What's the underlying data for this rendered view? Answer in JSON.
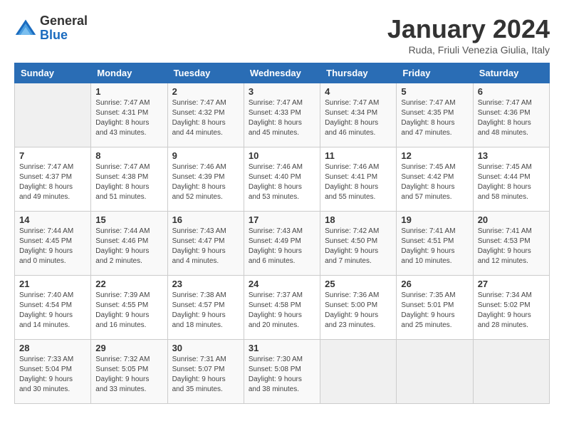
{
  "logo": {
    "general": "General",
    "blue": "Blue"
  },
  "header": {
    "month_title": "January 2024",
    "subtitle": "Ruda, Friuli Venezia Giulia, Italy"
  },
  "weekdays": [
    "Sunday",
    "Monday",
    "Tuesday",
    "Wednesday",
    "Thursday",
    "Friday",
    "Saturday"
  ],
  "weeks": [
    [
      {
        "day": "",
        "sunrise": "",
        "sunset": "",
        "daylight": ""
      },
      {
        "day": "1",
        "sunrise": "Sunrise: 7:47 AM",
        "sunset": "Sunset: 4:31 PM",
        "daylight": "Daylight: 8 hours and 43 minutes."
      },
      {
        "day": "2",
        "sunrise": "Sunrise: 7:47 AM",
        "sunset": "Sunset: 4:32 PM",
        "daylight": "Daylight: 8 hours and 44 minutes."
      },
      {
        "day": "3",
        "sunrise": "Sunrise: 7:47 AM",
        "sunset": "Sunset: 4:33 PM",
        "daylight": "Daylight: 8 hours and 45 minutes."
      },
      {
        "day": "4",
        "sunrise": "Sunrise: 7:47 AM",
        "sunset": "Sunset: 4:34 PM",
        "daylight": "Daylight: 8 hours and 46 minutes."
      },
      {
        "day": "5",
        "sunrise": "Sunrise: 7:47 AM",
        "sunset": "Sunset: 4:35 PM",
        "daylight": "Daylight: 8 hours and 47 minutes."
      },
      {
        "day": "6",
        "sunrise": "Sunrise: 7:47 AM",
        "sunset": "Sunset: 4:36 PM",
        "daylight": "Daylight: 8 hours and 48 minutes."
      }
    ],
    [
      {
        "day": "7",
        "sunrise": "Sunrise: 7:47 AM",
        "sunset": "Sunset: 4:37 PM",
        "daylight": "Daylight: 8 hours and 49 minutes."
      },
      {
        "day": "8",
        "sunrise": "Sunrise: 7:47 AM",
        "sunset": "Sunset: 4:38 PM",
        "daylight": "Daylight: 8 hours and 51 minutes."
      },
      {
        "day": "9",
        "sunrise": "Sunrise: 7:46 AM",
        "sunset": "Sunset: 4:39 PM",
        "daylight": "Daylight: 8 hours and 52 minutes."
      },
      {
        "day": "10",
        "sunrise": "Sunrise: 7:46 AM",
        "sunset": "Sunset: 4:40 PM",
        "daylight": "Daylight: 8 hours and 53 minutes."
      },
      {
        "day": "11",
        "sunrise": "Sunrise: 7:46 AM",
        "sunset": "Sunset: 4:41 PM",
        "daylight": "Daylight: 8 hours and 55 minutes."
      },
      {
        "day": "12",
        "sunrise": "Sunrise: 7:45 AM",
        "sunset": "Sunset: 4:42 PM",
        "daylight": "Daylight: 8 hours and 57 minutes."
      },
      {
        "day": "13",
        "sunrise": "Sunrise: 7:45 AM",
        "sunset": "Sunset: 4:44 PM",
        "daylight": "Daylight: 8 hours and 58 minutes."
      }
    ],
    [
      {
        "day": "14",
        "sunrise": "Sunrise: 7:44 AM",
        "sunset": "Sunset: 4:45 PM",
        "daylight": "Daylight: 9 hours and 0 minutes."
      },
      {
        "day": "15",
        "sunrise": "Sunrise: 7:44 AM",
        "sunset": "Sunset: 4:46 PM",
        "daylight": "Daylight: 9 hours and 2 minutes."
      },
      {
        "day": "16",
        "sunrise": "Sunrise: 7:43 AM",
        "sunset": "Sunset: 4:47 PM",
        "daylight": "Daylight: 9 hours and 4 minutes."
      },
      {
        "day": "17",
        "sunrise": "Sunrise: 7:43 AM",
        "sunset": "Sunset: 4:49 PM",
        "daylight": "Daylight: 9 hours and 6 minutes."
      },
      {
        "day": "18",
        "sunrise": "Sunrise: 7:42 AM",
        "sunset": "Sunset: 4:50 PM",
        "daylight": "Daylight: 9 hours and 7 minutes."
      },
      {
        "day": "19",
        "sunrise": "Sunrise: 7:41 AM",
        "sunset": "Sunset: 4:51 PM",
        "daylight": "Daylight: 9 hours and 10 minutes."
      },
      {
        "day": "20",
        "sunrise": "Sunrise: 7:41 AM",
        "sunset": "Sunset: 4:53 PM",
        "daylight": "Daylight: 9 hours and 12 minutes."
      }
    ],
    [
      {
        "day": "21",
        "sunrise": "Sunrise: 7:40 AM",
        "sunset": "Sunset: 4:54 PM",
        "daylight": "Daylight: 9 hours and 14 minutes."
      },
      {
        "day": "22",
        "sunrise": "Sunrise: 7:39 AM",
        "sunset": "Sunset: 4:55 PM",
        "daylight": "Daylight: 9 hours and 16 minutes."
      },
      {
        "day": "23",
        "sunrise": "Sunrise: 7:38 AM",
        "sunset": "Sunset: 4:57 PM",
        "daylight": "Daylight: 9 hours and 18 minutes."
      },
      {
        "day": "24",
        "sunrise": "Sunrise: 7:37 AM",
        "sunset": "Sunset: 4:58 PM",
        "daylight": "Daylight: 9 hours and 20 minutes."
      },
      {
        "day": "25",
        "sunrise": "Sunrise: 7:36 AM",
        "sunset": "Sunset: 5:00 PM",
        "daylight": "Daylight: 9 hours and 23 minutes."
      },
      {
        "day": "26",
        "sunrise": "Sunrise: 7:35 AM",
        "sunset": "Sunset: 5:01 PM",
        "daylight": "Daylight: 9 hours and 25 minutes."
      },
      {
        "day": "27",
        "sunrise": "Sunrise: 7:34 AM",
        "sunset": "Sunset: 5:02 PM",
        "daylight": "Daylight: 9 hours and 28 minutes."
      }
    ],
    [
      {
        "day": "28",
        "sunrise": "Sunrise: 7:33 AM",
        "sunset": "Sunset: 5:04 PM",
        "daylight": "Daylight: 9 hours and 30 minutes."
      },
      {
        "day": "29",
        "sunrise": "Sunrise: 7:32 AM",
        "sunset": "Sunset: 5:05 PM",
        "daylight": "Daylight: 9 hours and 33 minutes."
      },
      {
        "day": "30",
        "sunrise": "Sunrise: 7:31 AM",
        "sunset": "Sunset: 5:07 PM",
        "daylight": "Daylight: 9 hours and 35 minutes."
      },
      {
        "day": "31",
        "sunrise": "Sunrise: 7:30 AM",
        "sunset": "Sunset: 5:08 PM",
        "daylight": "Daylight: 9 hours and 38 minutes."
      },
      {
        "day": "",
        "sunrise": "",
        "sunset": "",
        "daylight": ""
      },
      {
        "day": "",
        "sunrise": "",
        "sunset": "",
        "daylight": ""
      },
      {
        "day": "",
        "sunrise": "",
        "sunset": "",
        "daylight": ""
      }
    ]
  ]
}
